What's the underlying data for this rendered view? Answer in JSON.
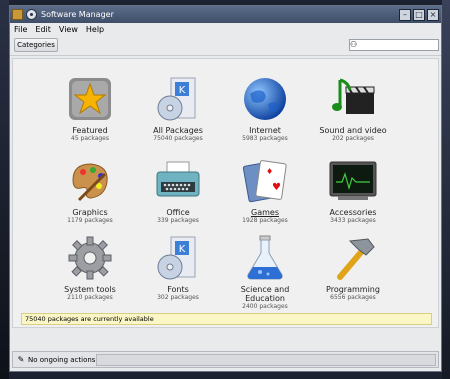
{
  "window": {
    "title": "Software Manager"
  },
  "menu": [
    "File",
    "Edit",
    "View",
    "Help"
  ],
  "toolbar": {
    "categories_label": "Categories",
    "search_value": ""
  },
  "categories": [
    {
      "label": "Featured",
      "count": "45 packages",
      "icon": "star-icon"
    },
    {
      "label": "All Packages",
      "count": "75040 packages",
      "icon": "package-cd-icon"
    },
    {
      "label": "Internet",
      "count": "5983 packages",
      "icon": "globe-icon"
    },
    {
      "label": "Sound and video",
      "count": "202 packages",
      "icon": "music-clapper-icon"
    },
    {
      "label": "Graphics",
      "count": "1179 packages",
      "icon": "palette-icon"
    },
    {
      "label": "Office",
      "count": "339 packages",
      "icon": "typewriter-icon"
    },
    {
      "label": "Games",
      "count": "1928 packages",
      "icon": "playing-cards-icon"
    },
    {
      "label": "Accessories",
      "count": "3433 packages",
      "icon": "terminal-icon"
    },
    {
      "label": "System tools",
      "count": "2110 packages",
      "icon": "gear-icon"
    },
    {
      "label": "Fonts",
      "count": "302 packages",
      "icon": "fonts-package-icon"
    },
    {
      "label": "Science and Education",
      "count": "2400 packages",
      "icon": "flask-icon"
    },
    {
      "label": "Programming",
      "count": "6556 packages",
      "icon": "hammer-icon"
    }
  ],
  "info": "75040 packages are currently available",
  "status": "No ongoing actions"
}
